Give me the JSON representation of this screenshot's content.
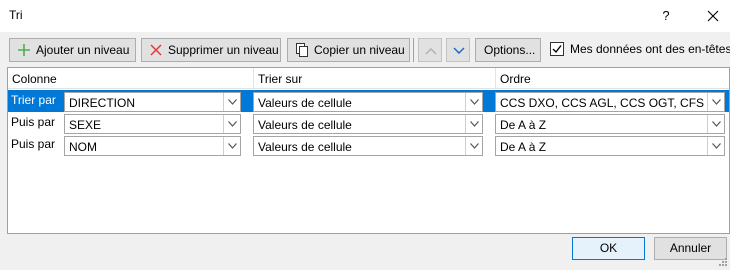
{
  "window": {
    "title": "Tri",
    "help_label": "?"
  },
  "toolbar": {
    "add_level": "Ajouter un niveau",
    "delete_level": "Supprimer un niveau",
    "copy_level": "Copier un niveau",
    "options": "Options...",
    "headers_checkbox_label": "Mes données ont des en-têtes",
    "headers_checked": true
  },
  "columns": {
    "column": "Colonne",
    "sort_on": "Trier sur",
    "order": "Ordre"
  },
  "rows": [
    {
      "label": "Trier par",
      "column": "DIRECTION",
      "sort_on": "Valeurs de cellule",
      "order": "CCS DXO, CCS AGL, CCS OGT, CFS CO, CCS",
      "selected": true
    },
    {
      "label": "Puis par",
      "column": "SEXE",
      "sort_on": "Valeurs de cellule",
      "order": "De A à Z",
      "selected": false
    },
    {
      "label": "Puis par",
      "column": "NOM",
      "sort_on": "Valeurs de cellule",
      "order": "De A à Z",
      "selected": false
    }
  ],
  "buttons": {
    "ok": "OK",
    "cancel": "Annuler"
  },
  "colors": {
    "selection": "#0078d7",
    "add_icon": "#4caf50",
    "delete_icon": "#e53935",
    "arrow_active": "#1565c0"
  }
}
